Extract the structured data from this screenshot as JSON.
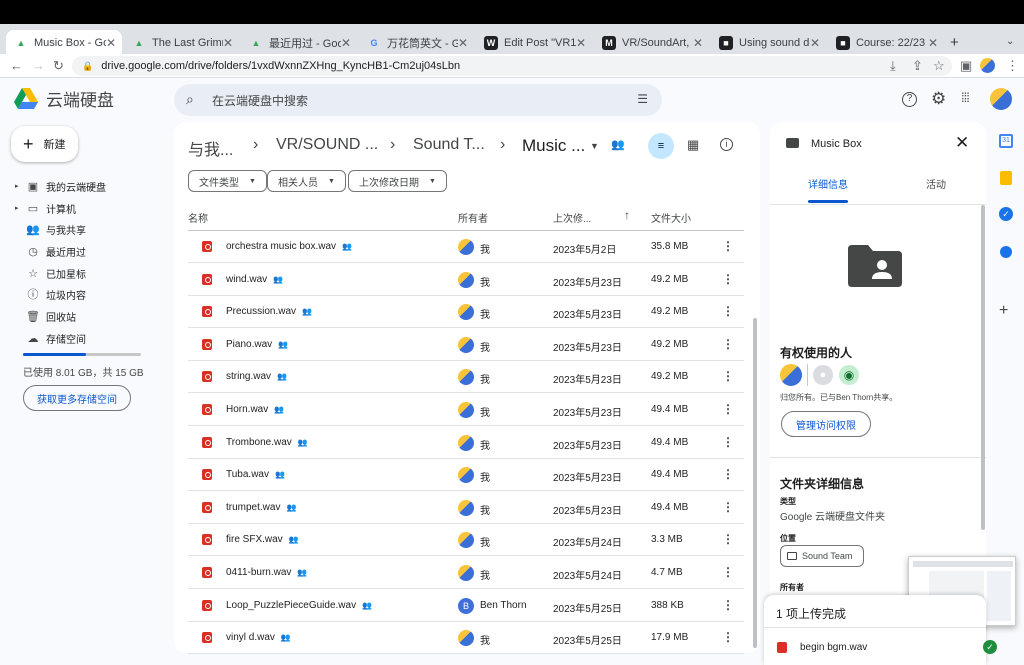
{
  "browser": {
    "tabs": [
      {
        "title": "Music Box - Google Drive",
        "favicon": "drive",
        "color": "#34a853"
      },
      {
        "title": "The Last Grimm Tale",
        "favicon": "drive",
        "color": "#34a853"
      },
      {
        "title": "最近用过 - Google Drive",
        "favicon": "drive",
        "color": "#34a853"
      },
      {
        "title": "万花筒英文 - Google Search",
        "favicon": "google",
        "color": "#4285f4"
      },
      {
        "title": "Edit Post \"VR12-W",
        "favicon": "W",
        "color": "#202124"
      },
      {
        "title": "VR/SoundArt, Online",
        "favicon": "M",
        "color": "#202124"
      },
      {
        "title": "Using sound design",
        "favicon": "■",
        "color": "#202124"
      },
      {
        "title": "Course: 22/23 Coll",
        "favicon": "■",
        "color": "#202124"
      }
    ],
    "url": "drive.google.com/drive/folders/1vxdWxnnZXHng_KyncHB1-Cm2uj04sLbn"
  },
  "app": {
    "name": "云端硬盘",
    "search_placeholder": "在云端硬盘中搜索"
  },
  "sidebar": {
    "new_label": "新建",
    "items": [
      {
        "label": "我的云端硬盘",
        "icon": "drive-icon"
      },
      {
        "label": "计算机",
        "icon": "computer-icon"
      },
      {
        "label": "与我共享",
        "icon": "people-icon"
      },
      {
        "label": "最近用过",
        "icon": "clock-icon"
      },
      {
        "label": "已加星标",
        "icon": "star-icon"
      },
      {
        "label": "垃圾内容",
        "icon": "spam-icon"
      },
      {
        "label": "回收站",
        "icon": "trash-icon"
      },
      {
        "label": "存储空间",
        "icon": "cloud-icon"
      }
    ],
    "storage_text": "已使用 8.01 GB，共 15 GB",
    "storage_fraction": 0.534,
    "get_storage_label": "获取更多存储空间"
  },
  "breadcrumb": [
    "与我...",
    "VR/SOUND ...",
    "Sound T...",
    "Music ..."
  ],
  "filters": [
    "文件类型",
    "相关人员",
    "上次修改日期"
  ],
  "columns": {
    "name": "名称",
    "owner": "所有者",
    "modified": "上次修...",
    "size": "文件大小"
  },
  "files": [
    {
      "name": "orchestra music box.wav",
      "owner": "我",
      "modified": "2023年5月2日",
      "size": "35.8 MB",
      "avatar": "me"
    },
    {
      "name": "wind.wav",
      "owner": "我",
      "modified": "2023年5月23日",
      "size": "49.2 MB",
      "avatar": "me"
    },
    {
      "name": "Precussion.wav",
      "owner": "我",
      "modified": "2023年5月23日",
      "size": "49.2 MB",
      "avatar": "me"
    },
    {
      "name": "Piano.wav",
      "owner": "我",
      "modified": "2023年5月23日",
      "size": "49.2 MB",
      "avatar": "me"
    },
    {
      "name": "string.wav",
      "owner": "我",
      "modified": "2023年5月23日",
      "size": "49.2 MB",
      "avatar": "me"
    },
    {
      "name": "Horn.wav",
      "owner": "我",
      "modified": "2023年5月23日",
      "size": "49.4 MB",
      "avatar": "me"
    },
    {
      "name": "Trombone.wav",
      "owner": "我",
      "modified": "2023年5月23日",
      "size": "49.4 MB",
      "avatar": "me"
    },
    {
      "name": "Tuba.wav",
      "owner": "我",
      "modified": "2023年5月23日",
      "size": "49.4 MB",
      "avatar": "me"
    },
    {
      "name": "trumpet.wav",
      "owner": "我",
      "modified": "2023年5月23日",
      "size": "49.4 MB",
      "avatar": "me"
    },
    {
      "name": "fire SFX.wav",
      "owner": "我",
      "modified": "2023年5月24日",
      "size": "3.3 MB",
      "avatar": "me"
    },
    {
      "name": "0411-burn.wav",
      "owner": "我",
      "modified": "2023年5月24日",
      "size": "4.7 MB",
      "avatar": "me"
    },
    {
      "name": "Loop_PuzzlePieceGuide.wav",
      "owner": "Ben Thorn",
      "modified": "2023年5月25日",
      "size": "388 KB",
      "avatar": "B"
    },
    {
      "name": "vinyl d.wav",
      "owner": "我",
      "modified": "2023年5月25日",
      "size": "17.9 MB",
      "avatar": "me"
    }
  ],
  "details": {
    "title": "Music Box",
    "tabs": [
      "详细信息",
      "活动"
    ],
    "access_heading": "有权使用的人",
    "access_text": "归您所有。已与Ben Thorn共享。",
    "manage_label": "管理访问权限",
    "folder_details_heading": "文件夹详细信息",
    "type_label": "类型",
    "type_value": "Google 云端硬盘文件夹",
    "location_label": "位置",
    "location_value": "Sound Team",
    "owner_label": "所有者"
  },
  "upload": {
    "status": "1 项上传完成",
    "file": "begin bgm.wav"
  }
}
